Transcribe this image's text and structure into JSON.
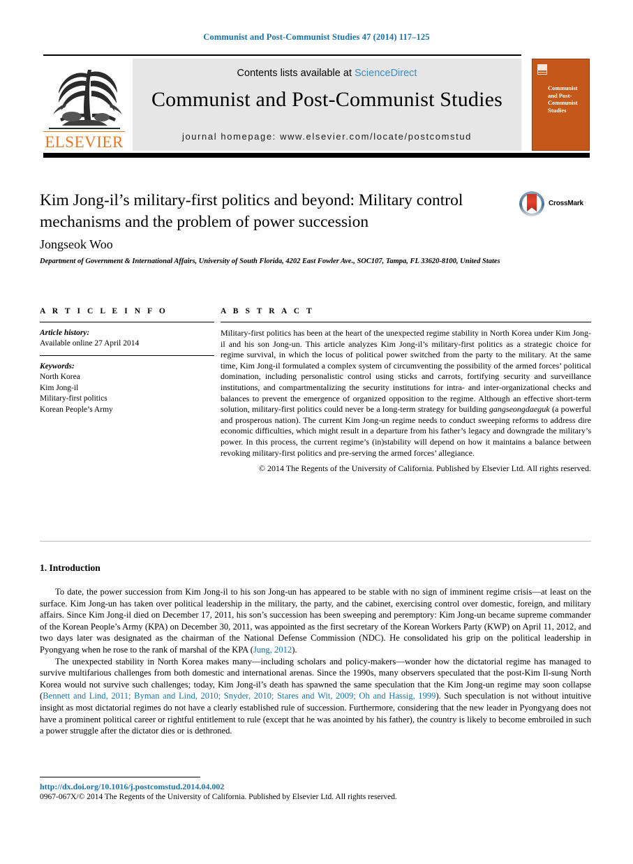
{
  "running_head": "Communist and Post-Communist Studies 47 (2014) 117–125",
  "masthead": {
    "contents_prefix": "Contents lists available at ",
    "sciencedirect": "ScienceDirect",
    "journal_title": "Communist and Post-Communist Studies",
    "homepage": "journal homepage: www.elsevier.com/locate/postcomstud",
    "publisher_wordmark": "ELSEVIER",
    "cover_title": "Communist and Post-Communist Studies",
    "link_color": "#3c8dc5",
    "cover_color": "#c4571a",
    "publisher_color": "#e87722"
  },
  "article": {
    "title": "Kim Jong-il’s military-first politics and beyond: Military control mechanisms and the problem of power succession",
    "author": "Jongseok Woo",
    "affiliation": "Department of Government & International Affairs, University of South Florida, 4202 East Fowler Ave., SOC107, Tampa, FL 33620-8100, United States",
    "crossmark_label": "CrossMark"
  },
  "article_info": {
    "heading": "A R T I C L E   I N F O",
    "history_label": "Article history:",
    "history_value": "Available online 27 April 2014",
    "keywords_label": "Keywords:",
    "keywords": [
      "North Korea",
      "Kim Jong-il",
      "Military-first politics",
      "Korean People’s Army"
    ]
  },
  "abstract": {
    "heading": "A B S T R A C T",
    "part1": "Military-first politics has been at the heart of the unexpected regime stability in North Korea under Kim Jong-il and his son Jong-un. This article analyzes Kim Jong-il’s military-first politics as a strategic choice for regime survival, in which the locus of political power switched from the party to the military. At the same time, Kim Jong-il formulated a complex system of circumventing the possibility of the armed forces’ political domination, including personalistic control using sticks and carrots, fortifying security and surveillance institutions, and compartmentalizing the security institutions for intra- and inter-organizational checks and balances to prevent the emergence of organized opposition to the regime. Although an effective short-term solution, military-first politics could never be a long-term strategy for building ",
    "italic_term": "gangseongdaeguk",
    "part2": " (a powerful and prosperous nation). The current Kim Jong-un regime needs to conduct sweeping reforms to address dire economic difficulties, which might result in a departure from his father’s legacy and downgrade the military’s power. In this process, the current regime’s (in)stability will depend on how it maintains a balance between revoking military-first politics and pre-serving the armed forces’ allegiance.",
    "copyright": "© 2014 The Regents of the University of California. Published by Elsevier Ltd. All rights reserved."
  },
  "body": {
    "section_title": "1. Introduction",
    "paragraph1_a": "To date, the power succession from Kim Jong-il to his son Jong-un has appeared to be stable with no sign of imminent regime crisis—at least on the surface. Kim Jong-un has taken over political leadership in the military, the party, and the cabinet, exercising control over domestic, foreign, and military affairs. Since Kim Jong-il died on December 17, 2011, his son’s succession has been sweeping and peremptory: Kim Jong-un became supreme commander of the Korean People’s Army (KPA) on December 30, 2011, was appointed as the first secretary of the Korean Workers Party (KWP) on April 11, 2012, and two days later was designated as the chairman of the National Defense Commission (NDC). He consolidated his grip on the political leadership in Pyongyang when he rose to the rank of marshal of the KPA (",
    "paragraph1_cite": "Jung, 2012",
    "paragraph1_b": ").",
    "paragraph2_a": "The unexpected stability in North Korea makes many—including scholars and policy-makers—wonder how the dictatorial regime has managed to survive multifarious challenges from both domestic and international arenas. Since the 1990s, many observers speculated that the post-Kim Il-sung North Korea would not survive such challenges; today, Kim Jong-il’s death has spawned the same speculation that the Kim Jong-un regime may soon collapse (",
    "paragraph2_cite": "Bennett and Lind, 2011; Byman and Lind, 2010; Snyder, 2010; Stares and Wit, 2009; Oh and Hassig, 1999",
    "paragraph2_b": "). Such speculation is not without intuitive insight as most dictatorial regimes do not have a clearly established rule of succession. Furthermore, considering that the new leader in Pyongyang does not have a prominent political career or rightful entitlement to rule (except that he was anointed by his father), the country is likely to become embroiled in such a power struggle after the dictator dies or is dethroned.",
    "cite_color": "#1a72a8"
  },
  "footer": {
    "doi": "http://dx.doi.org/10.1016/j.postcomstud.2014.04.002",
    "issn_copyright": "0967-067X/© 2014 The Regents of the University of California. Published by Elsevier Ltd. All rights reserved."
  }
}
